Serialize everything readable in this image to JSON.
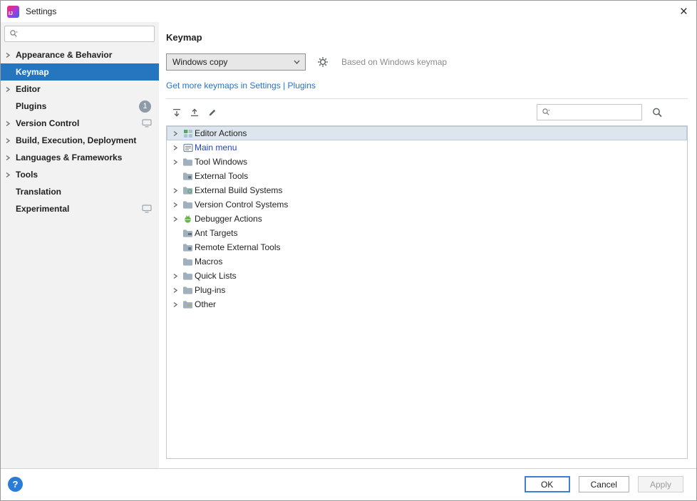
{
  "window": {
    "title": "Settings",
    "close_glyph": "×"
  },
  "colors": {
    "accent": "#2675bf",
    "sidebar_selection_bg": "#2675bf",
    "link": "#2872ca",
    "modified_item_text": "#2145c4",
    "disabled_text": "#9c9c9c",
    "tree_selection_bg": "#dde6ef"
  },
  "sidebar": {
    "search": {
      "placeholder": "",
      "value": "",
      "icon": "search-icon"
    },
    "items": [
      {
        "label": "Appearance & Behavior",
        "chevron": true
      },
      {
        "label": "Keymap",
        "selected": true
      },
      {
        "label": "Editor",
        "chevron": true
      },
      {
        "label": "Plugins",
        "badge": "1"
      },
      {
        "label": "Version Control",
        "chevron": true,
        "trailing_icon": "settings-group-icon"
      },
      {
        "label": "Build, Execution, Deployment",
        "chevron": true
      },
      {
        "label": "Languages & Frameworks",
        "chevron": true
      },
      {
        "label": "Tools",
        "chevron": true
      },
      {
        "label": "Translation"
      },
      {
        "label": "Experimental",
        "trailing_icon": "settings-group-icon"
      }
    ]
  },
  "main": {
    "title": "Keymap",
    "keymap_selector": {
      "value": "Windows copy",
      "arrow_icon": "chevron-down-icon"
    },
    "gear_icon": "gear-icon",
    "based_on_text": "Based on Windows keymap",
    "plugins_link": "Get more keymaps in Settings | Plugins",
    "toolbar": {
      "icons": [
        "expand-all-icon",
        "collapse-all-icon",
        "edit-icon"
      ],
      "search": {
        "placeholder": "",
        "value": "",
        "icon": "search-icon"
      },
      "find_shortcut_icon": "find-by-shortcut-icon"
    },
    "tree": [
      {
        "label": "Editor Actions",
        "chevron": true,
        "icon": "editor-actions-icon",
        "selected": true
      },
      {
        "label": "Main menu",
        "chevron": true,
        "icon": "main-menu-icon",
        "modified": true
      },
      {
        "label": "Tool Windows",
        "chevron": true,
        "icon": "folder-icon"
      },
      {
        "label": "External Tools",
        "icon": "external-tools-icon"
      },
      {
        "label": "External Build Systems",
        "chevron": true,
        "icon": "build-systems-icon"
      },
      {
        "label": "Version Control Systems",
        "chevron": true,
        "icon": "folder-icon"
      },
      {
        "label": "Debugger Actions",
        "chevron": true,
        "icon": "debugger-icon"
      },
      {
        "label": "Ant Targets",
        "icon": "ant-icon"
      },
      {
        "label": "Remote External Tools",
        "icon": "external-tools-icon"
      },
      {
        "label": "Macros",
        "icon": "folder-icon"
      },
      {
        "label": "Quick Lists",
        "chevron": true,
        "icon": "folder-icon"
      },
      {
        "label": "Plug-ins",
        "chevron": true,
        "icon": "folder-icon"
      },
      {
        "label": "Other",
        "chevron": true,
        "icon": "other-icon"
      }
    ]
  },
  "footer": {
    "help_glyph": "?",
    "buttons": [
      {
        "label": "OK",
        "default": true
      },
      {
        "label": "Cancel"
      },
      {
        "label": "Apply",
        "disabled": true
      }
    ]
  }
}
